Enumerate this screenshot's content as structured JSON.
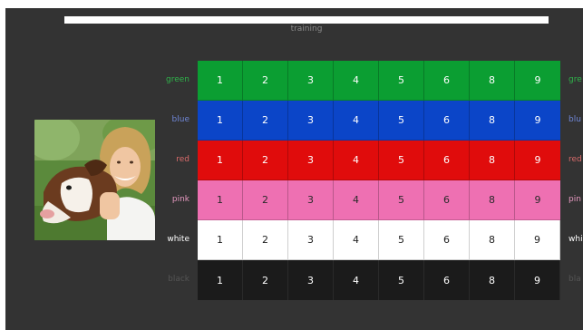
{
  "header": {
    "progress_percent": 100,
    "mode_label": "training"
  },
  "photo": {
    "subject": "woman-hugging-dog-photo"
  },
  "grid": {
    "numbers": [
      "1",
      "2",
      "3",
      "4",
      "5",
      "6",
      "8",
      "9"
    ],
    "rows": [
      {
        "key": "green",
        "label": "green",
        "right_label": "gre",
        "color": "#0b9e32",
        "text_color": "#ffffff",
        "label_color": "#2fb34a"
      },
      {
        "key": "blue",
        "label": "blue",
        "right_label": "blu",
        "color": "#0b45c8",
        "text_color": "#ffffff",
        "label_color": "#6f86d6"
      },
      {
        "key": "red",
        "label": "red",
        "right_label": "red",
        "color": "#e00c0c",
        "text_color": "#ffffff",
        "label_color": "#d96b6b"
      },
      {
        "key": "pink",
        "label": "pink",
        "right_label": "pin",
        "color": "#ee70b2",
        "text_color": "#2a2a2a",
        "label_color": "#e89ac2"
      },
      {
        "key": "white",
        "label": "white",
        "right_label": "whi",
        "color": "#ffffff",
        "text_color": "#222222",
        "label_color": "#ffffff"
      },
      {
        "key": "black",
        "label": "black",
        "right_label": "bla",
        "color": "#1b1b1b",
        "text_color": "#ffffff",
        "label_color": "#555555"
      }
    ]
  }
}
